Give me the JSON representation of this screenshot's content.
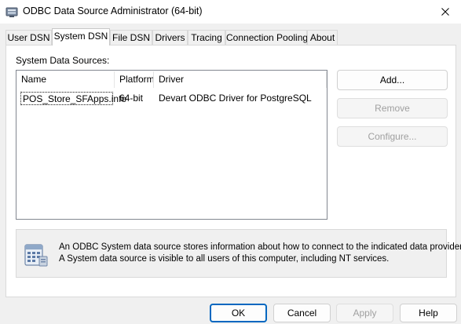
{
  "window": {
    "title": "ODBC Data Source Administrator (64-bit)",
    "icon": "odbc-admin-icon"
  },
  "tabs": [
    {
      "label": "User DSN",
      "active": false
    },
    {
      "label": "System DSN",
      "active": true
    },
    {
      "label": "File DSN",
      "active": false
    },
    {
      "label": "Drivers",
      "active": false
    },
    {
      "label": "Tracing",
      "active": false
    },
    {
      "label": "Connection Pooling",
      "active": false
    },
    {
      "label": "About",
      "active": false
    }
  ],
  "system_dsn": {
    "section_label": "System Data Sources:",
    "columns": [
      "Name",
      "Platform",
      "Driver"
    ],
    "rows": [
      {
        "name": "POS_Store_SFApps.info",
        "platform": "64-bit",
        "driver": "Devart ODBC Driver for PostgreSQL"
      }
    ],
    "buttons": {
      "add": "Add...",
      "remove": "Remove",
      "configure": "Configure..."
    },
    "info": {
      "icon": "data-source-info-icon",
      "line1": "An ODBC System data source stores information about how to connect to the indicated data provider.",
      "line2": "A System data source is visible to all users of this computer, including NT services."
    }
  },
  "footer": {
    "ok": "OK",
    "cancel": "Cancel",
    "apply": "Apply",
    "help": "Help"
  },
  "colors": {
    "accent": "#0067c0",
    "disabled_text": "#a0a0a0"
  }
}
